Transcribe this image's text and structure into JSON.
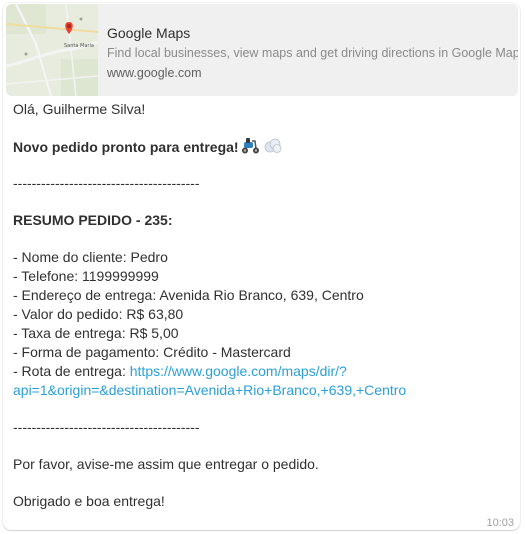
{
  "preview": {
    "title": "Google Maps",
    "description": "Find local businesses, view maps and get driving directions in Google Maps.",
    "domain": "www.google.com",
    "thumbnail_label": "Santa Maria"
  },
  "message": {
    "greeting": "Olá, Guilherme Silva!",
    "headline": "Novo pedido pronto para entrega!",
    "divider": "----------------------------------------",
    "summary_title": "RESUMO PEDIDO - 235:",
    "items": [
      "- Nome do cliente: Pedro",
      "- Telefone: 1199999999",
      "- Endereço de entrega: Avenida Rio Branco, 639, Centro",
      "- Valor do pedido: R$ 63,80",
      "- Taxa de entrega: R$ 5,00",
      "- Forma de pagamento: Crédito - Mastercard"
    ],
    "route_label": "- Rota de entrega: ",
    "route_link_line1": "https://www.google.com/maps/dir/?",
    "route_link_line2": "api=1&origin=&destination=Avenida+Rio+Branco,+639,+Centro",
    "request": "Por favor, avise-me assim que entregar o pedido.",
    "closing": "Obrigado e boa entrega!",
    "time": "10:03"
  },
  "colors": {
    "link": "#2a9fd8",
    "preview_bg": "#f0f0f0",
    "text": "#303030"
  }
}
